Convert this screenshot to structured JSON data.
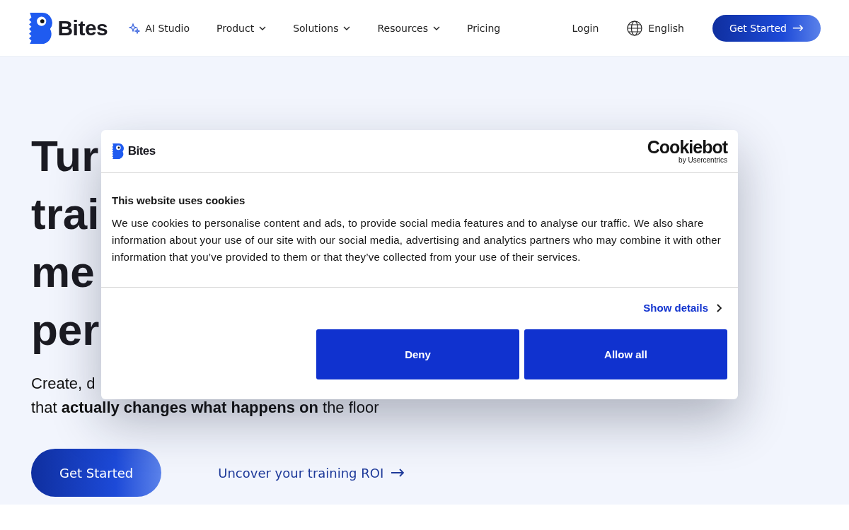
{
  "nav": {
    "brand": "Bites",
    "items": [
      {
        "label": "AI Studio",
        "kind": "sparkle"
      },
      {
        "label": "Product",
        "kind": "dropdown"
      },
      {
        "label": "Solutions",
        "kind": "dropdown"
      },
      {
        "label": "Resources",
        "kind": "dropdown"
      },
      {
        "label": "Pricing",
        "kind": "plain"
      }
    ],
    "login": "Login",
    "language": "English",
    "cta": "Get Started"
  },
  "hero": {
    "heading_lines": [
      "Tur",
      "trai",
      "me",
      "per"
    ],
    "subtitle_lines": [
      "Create, d",
      "that **actually changes what happens on** the floor"
    ],
    "cta": "Get Started",
    "link": "Uncover your training ROI"
  },
  "cookie_dialog": {
    "brand": "Bites",
    "vendor": "Cookiebot",
    "vendor_sub": "by Usercentrics",
    "title": "This website uses cookies",
    "body": "We use cookies to personalise content and ads, to provide social media features and to analyse our traffic. We also share information about your use of our site with our social media, advertising and analytics partners who may combine it with other information that you’ve provided to them or that they’ve collected from your use of their services.",
    "details_link": "Show details",
    "buttons": [
      "Deny",
      "Allow all"
    ]
  }
}
